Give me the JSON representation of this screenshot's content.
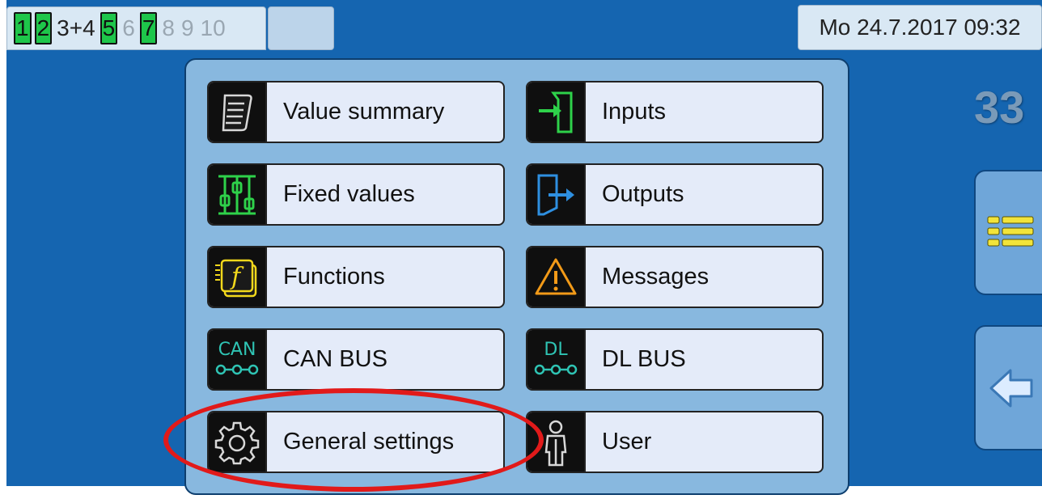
{
  "top_bar": {
    "tabs": [
      "1",
      "2",
      "3+4",
      "5",
      "6",
      "7",
      "8",
      "9",
      "10"
    ],
    "datetime": "Mo 24.7.2017 09:32"
  },
  "counter": "33",
  "menu": {
    "value_summary": "Value summary",
    "inputs": "Inputs",
    "fixed_values": "Fixed values",
    "outputs": "Outputs",
    "functions": "Functions",
    "messages": "Messages",
    "can_bus": "CAN BUS",
    "dl_bus": "DL BUS",
    "general_settings": "General settings",
    "user": "User"
  },
  "icon_text": {
    "can": "CAN",
    "dl": "DL",
    "function": "f"
  },
  "colors": {
    "background": "#1565b0",
    "panel": "#88b8df",
    "active_tab": "#1ec64a",
    "highlight": "#e11a1a"
  },
  "icons": {
    "value_summary": "document-list-icon",
    "inputs": "input-arrow-icon",
    "fixed_values": "sliders-icon",
    "outputs": "output-arrow-icon",
    "functions": "function-f-icon",
    "messages": "warning-triangle-icon",
    "can_bus": "can-bus-icon",
    "dl_bus": "dl-bus-icon",
    "general_settings": "gear-icon",
    "user": "user-icon",
    "list": "list-icon",
    "back": "back-arrow-icon"
  }
}
